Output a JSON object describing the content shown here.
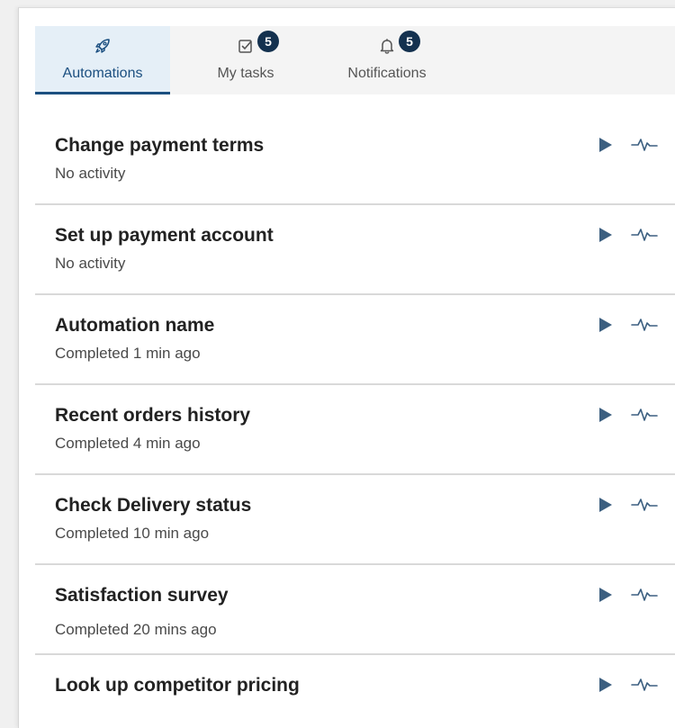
{
  "colors": {
    "accent": "#1b4f80",
    "badge": "#14314f",
    "icon": "#3c5f80",
    "active_tab_bg": "#e5eff7"
  },
  "tabs": [
    {
      "label": "Automations",
      "icon": "rocket-icon",
      "active": true
    },
    {
      "label": "My tasks",
      "icon": "checkbox-icon",
      "badge": "5"
    },
    {
      "label": "Notifications",
      "icon": "bell-icon",
      "badge": "5"
    }
  ],
  "automations": [
    {
      "title": "Change payment terms",
      "status": "No activity"
    },
    {
      "title": "Set up payment account",
      "status": "No activity"
    },
    {
      "title": "Automation name",
      "status": "Completed 1 min ago"
    },
    {
      "title": "Recent orders history",
      "status": "Completed 4 min ago"
    },
    {
      "title": "Check Delivery status",
      "status": "Completed 10 min ago"
    },
    {
      "title": "Satisfaction survey",
      "status": "Completed 20 mins ago"
    },
    {
      "title": "Look up competitor pricing",
      "status": ""
    }
  ],
  "row_icons": {
    "run": "play-icon",
    "activity": "activity-pulse-icon"
  }
}
